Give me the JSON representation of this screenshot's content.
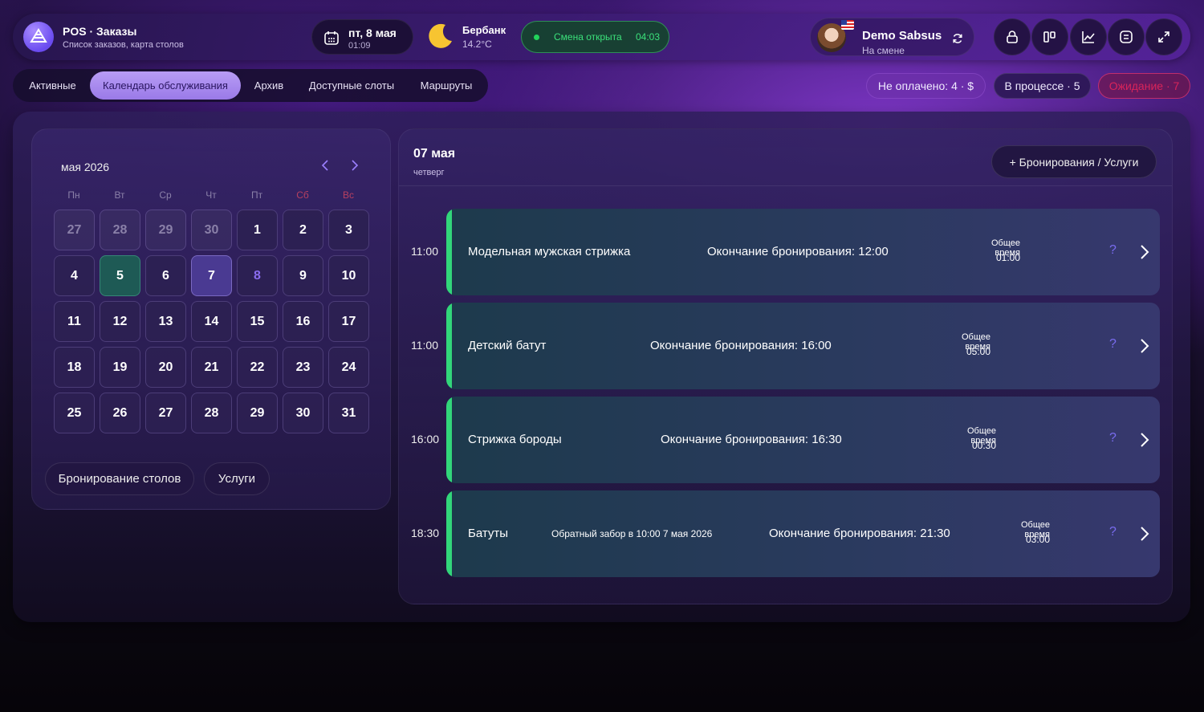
{
  "header": {
    "app_title": "POS · Заказы",
    "app_subtitle": "Список заказов, карта столов",
    "date": "пт, 8 мая",
    "time": "01:09",
    "weather_city": "Бербанк",
    "weather_temp": "14.2°C",
    "shift_label": "Смена открыта",
    "shift_timer": "04:03",
    "user_name": "Demo Sabsus",
    "user_status": "На смене",
    "icons": [
      "lock-icon",
      "columns-icon",
      "chart-icon",
      "receipt-icon",
      "fullscreen-icon"
    ]
  },
  "tabs": [
    {
      "label": "Активные",
      "active": false
    },
    {
      "label": "Календарь обслуживания",
      "active": true
    },
    {
      "label": "Архив",
      "active": false
    },
    {
      "label": "Доступные слоты",
      "active": false
    },
    {
      "label": "Маршруты",
      "active": false
    }
  ],
  "status": {
    "unpaid": "Не оплачено: 4 · $",
    "in_progress": "В процессе · 5",
    "waiting": "Ожидание · 7"
  },
  "calendar": {
    "month_label": "мая 2026",
    "weekdays": [
      "Пн",
      "Вт",
      "Ср",
      "Чт",
      "Пт",
      "Сб",
      "Вс"
    ],
    "days": [
      {
        "n": "27",
        "state": "muted"
      },
      {
        "n": "28",
        "state": "muted"
      },
      {
        "n": "29",
        "state": "muted"
      },
      {
        "n": "30",
        "state": "muted"
      },
      {
        "n": "1",
        "state": ""
      },
      {
        "n": "2",
        "state": ""
      },
      {
        "n": "3",
        "state": ""
      },
      {
        "n": "4",
        "state": ""
      },
      {
        "n": "5",
        "state": "today"
      },
      {
        "n": "6",
        "state": ""
      },
      {
        "n": "7",
        "state": "selected"
      },
      {
        "n": "8",
        "state": "current"
      },
      {
        "n": "9",
        "state": ""
      },
      {
        "n": "10",
        "state": ""
      },
      {
        "n": "11",
        "state": ""
      },
      {
        "n": "12",
        "state": ""
      },
      {
        "n": "13",
        "state": ""
      },
      {
        "n": "14",
        "state": ""
      },
      {
        "n": "15",
        "state": ""
      },
      {
        "n": "16",
        "state": ""
      },
      {
        "n": "17",
        "state": ""
      },
      {
        "n": "18",
        "state": ""
      },
      {
        "n": "19",
        "state": ""
      },
      {
        "n": "20",
        "state": ""
      },
      {
        "n": "21",
        "state": ""
      },
      {
        "n": "22",
        "state": ""
      },
      {
        "n": "23",
        "state": ""
      },
      {
        "n": "24",
        "state": ""
      },
      {
        "n": "25",
        "state": ""
      },
      {
        "n": "26",
        "state": ""
      },
      {
        "n": "27",
        "state": ""
      },
      {
        "n": "28",
        "state": ""
      },
      {
        "n": "29",
        "state": ""
      },
      {
        "n": "30",
        "state": ""
      },
      {
        "n": "31",
        "state": ""
      }
    ],
    "table_booking_label": "Бронирование столов",
    "services_label": "Услуги"
  },
  "schedule": {
    "date": "07 мая",
    "weekday": "четверг",
    "add_label": "+ Бронирования / Услуги",
    "total_label": "Общее время",
    "bookings": [
      {
        "time": "11:00",
        "name": "Модельная мужская стрижка",
        "extra": "",
        "end": "Окончание бронирования: 12:00",
        "total": "01:00"
      },
      {
        "time": "11:00",
        "name": "Детский батут",
        "extra": "",
        "end": "Окончание бронирования: 16:00",
        "total": "05:00"
      },
      {
        "time": "16:00",
        "name": "Стрижка бороды",
        "extra": "",
        "end": "Окончание бронирования: 16:30",
        "total": "00:30"
      },
      {
        "time": "18:30",
        "name": "Батуты",
        "extra": "Обратный забор в 10:00 7 мая 2026",
        "end": "Окончание бронирования: 21:30",
        "total": "03:00"
      }
    ]
  },
  "colors": {
    "accent": "#9a7ae8",
    "booking_bar": "#32d67a",
    "shift_green": "#22d35b",
    "waiting_red": "#d8245a"
  }
}
